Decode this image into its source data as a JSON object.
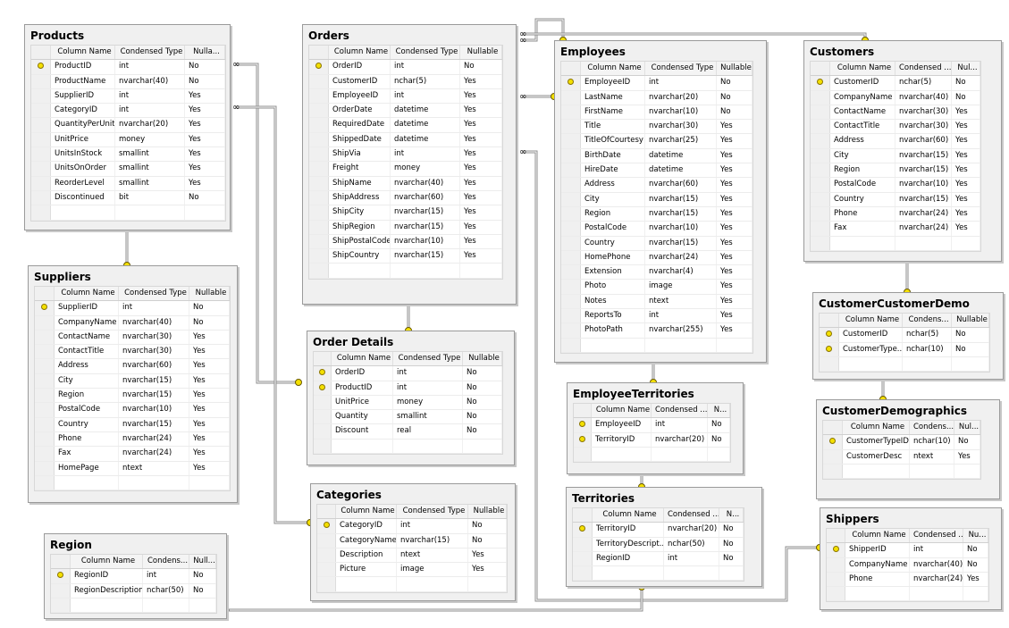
{
  "headers": [
    "Column Name",
    "Condensed Type",
    "Nullable"
  ],
  "colors": {
    "key": "#f4e000",
    "line": "#8c8c8c",
    "border": "#9a9a9a",
    "table_bg": "#f0f0f0"
  },
  "tables": [
    {
      "id": "products",
      "name": "Products",
      "headers": [
        "Column Name",
        "Condensed Type",
        "Nulla..."
      ],
      "rows": [
        [
          "ProductID",
          "int",
          "No",
          1
        ],
        [
          "ProductName",
          "nvarchar(40)",
          "No",
          0
        ],
        [
          "SupplierID",
          "int",
          "Yes",
          0
        ],
        [
          "CategoryID",
          "int",
          "Yes",
          0
        ],
        [
          "QuantityPerUnit",
          "nvarchar(20)",
          "Yes",
          0
        ],
        [
          "UnitPrice",
          "money",
          "Yes",
          0
        ],
        [
          "UnitsInStock",
          "smallint",
          "Yes",
          0
        ],
        [
          "UnitsOnOrder",
          "smallint",
          "Yes",
          0
        ],
        [
          "ReorderLevel",
          "smallint",
          "Yes",
          0
        ],
        [
          "Discontinued",
          "bit",
          "No",
          0
        ]
      ]
    },
    {
      "id": "orders",
      "name": "Orders",
      "headers": [
        "Column Name",
        "Condensed Type",
        "Nullable"
      ],
      "rows": [
        [
          "OrderID",
          "int",
          "No",
          1
        ],
        [
          "CustomerID",
          "nchar(5)",
          "Yes",
          0
        ],
        [
          "EmployeeID",
          "int",
          "Yes",
          0
        ],
        [
          "OrderDate",
          "datetime",
          "Yes",
          0
        ],
        [
          "RequiredDate",
          "datetime",
          "Yes",
          0
        ],
        [
          "ShippedDate",
          "datetime",
          "Yes",
          0
        ],
        [
          "ShipVia",
          "int",
          "Yes",
          0
        ],
        [
          "Freight",
          "money",
          "Yes",
          0
        ],
        [
          "ShipName",
          "nvarchar(40)",
          "Yes",
          0
        ],
        [
          "ShipAddress",
          "nvarchar(60)",
          "Yes",
          0
        ],
        [
          "ShipCity",
          "nvarchar(15)",
          "Yes",
          0
        ],
        [
          "ShipRegion",
          "nvarchar(15)",
          "Yes",
          0
        ],
        [
          "ShipPostalCode",
          "nvarchar(10)",
          "Yes",
          0
        ],
        [
          "ShipCountry",
          "nvarchar(15)",
          "Yes",
          0
        ]
      ]
    },
    {
      "id": "employees",
      "name": "Employees",
      "headers": [
        "Column Name",
        "Condensed Type",
        "Nullable"
      ],
      "rows": [
        [
          "EmployeeID",
          "int",
          "No",
          1
        ],
        [
          "LastName",
          "nvarchar(20)",
          "No",
          0
        ],
        [
          "FirstName",
          "nvarchar(10)",
          "No",
          0
        ],
        [
          "Title",
          "nvarchar(30)",
          "Yes",
          0
        ],
        [
          "TitleOfCourtesy",
          "nvarchar(25)",
          "Yes",
          0
        ],
        [
          "BirthDate",
          "datetime",
          "Yes",
          0
        ],
        [
          "HireDate",
          "datetime",
          "Yes",
          0
        ],
        [
          "Address",
          "nvarchar(60)",
          "Yes",
          0
        ],
        [
          "City",
          "nvarchar(15)",
          "Yes",
          0
        ],
        [
          "Region",
          "nvarchar(15)",
          "Yes",
          0
        ],
        [
          "PostalCode",
          "nvarchar(10)",
          "Yes",
          0
        ],
        [
          "Country",
          "nvarchar(15)",
          "Yes",
          0
        ],
        [
          "HomePhone",
          "nvarchar(24)",
          "Yes",
          0
        ],
        [
          "Extension",
          "nvarchar(4)",
          "Yes",
          0
        ],
        [
          "Photo",
          "image",
          "Yes",
          0
        ],
        [
          "Notes",
          "ntext",
          "Yes",
          0
        ],
        [
          "ReportsTo",
          "int",
          "Yes",
          0
        ],
        [
          "PhotoPath",
          "nvarchar(255)",
          "Yes",
          0
        ]
      ]
    },
    {
      "id": "customers",
      "name": "Customers",
      "headers": [
        "Column Name",
        "Condensed ...",
        "Nul..."
      ],
      "rows": [
        [
          "CustomerID",
          "nchar(5)",
          "No",
          1
        ],
        [
          "CompanyName",
          "nvarchar(40)",
          "No",
          0
        ],
        [
          "ContactName",
          "nvarchar(30)",
          "Yes",
          0
        ],
        [
          "ContactTitle",
          "nvarchar(30)",
          "Yes",
          0
        ],
        [
          "Address",
          "nvarchar(60)",
          "Yes",
          0
        ],
        [
          "City",
          "nvarchar(15)",
          "Yes",
          0
        ],
        [
          "Region",
          "nvarchar(15)",
          "Yes",
          0
        ],
        [
          "PostalCode",
          "nvarchar(10)",
          "Yes",
          0
        ],
        [
          "Country",
          "nvarchar(15)",
          "Yes",
          0
        ],
        [
          "Phone",
          "nvarchar(24)",
          "Yes",
          0
        ],
        [
          "Fax",
          "nvarchar(24)",
          "Yes",
          0
        ]
      ]
    },
    {
      "id": "suppliers",
      "name": "Suppliers",
      "headers": [
        "Column Name",
        "Condensed Type",
        "Nullable"
      ],
      "rows": [
        [
          "SupplierID",
          "int",
          "No",
          1
        ],
        [
          "CompanyName",
          "nvarchar(40)",
          "No",
          0
        ],
        [
          "ContactName",
          "nvarchar(30)",
          "Yes",
          0
        ],
        [
          "ContactTitle",
          "nvarchar(30)",
          "Yes",
          0
        ],
        [
          "Address",
          "nvarchar(60)",
          "Yes",
          0
        ],
        [
          "City",
          "nvarchar(15)",
          "Yes",
          0
        ],
        [
          "Region",
          "nvarchar(15)",
          "Yes",
          0
        ],
        [
          "PostalCode",
          "nvarchar(10)",
          "Yes",
          0
        ],
        [
          "Country",
          "nvarchar(15)",
          "Yes",
          0
        ],
        [
          "Phone",
          "nvarchar(24)",
          "Yes",
          0
        ],
        [
          "Fax",
          "nvarchar(24)",
          "Yes",
          0
        ],
        [
          "HomePage",
          "ntext",
          "Yes",
          0
        ]
      ]
    },
    {
      "id": "orderdetails",
      "name": "Order Details",
      "headers": [
        "Column Name",
        "Condensed Type",
        "Nullable"
      ],
      "rows": [
        [
          "OrderID",
          "int",
          "No",
          1
        ],
        [
          "ProductID",
          "int",
          "No",
          1
        ],
        [
          "UnitPrice",
          "money",
          "No",
          0
        ],
        [
          "Quantity",
          "smallint",
          "No",
          0
        ],
        [
          "Discount",
          "real",
          "No",
          0
        ]
      ]
    },
    {
      "id": "categories",
      "name": "Categories",
      "headers": [
        "Column Name",
        "Condensed Type",
        "Nullable"
      ],
      "rows": [
        [
          "CategoryID",
          "int",
          "No",
          1
        ],
        [
          "CategoryName",
          "nvarchar(15)",
          "No",
          0
        ],
        [
          "Description",
          "ntext",
          "Yes",
          0
        ],
        [
          "Picture",
          "image",
          "Yes",
          0
        ]
      ]
    },
    {
      "id": "region",
      "name": "Region",
      "headers": [
        "Column Name",
        "Condens...",
        "Null..."
      ],
      "rows": [
        [
          "RegionID",
          "int",
          "No",
          1
        ],
        [
          "RegionDescription",
          "nchar(50)",
          "No",
          0
        ]
      ]
    },
    {
      "id": "empterr",
      "name": "EmployeeTerritories",
      "headers": [
        "Column Name",
        "Condensed ...",
        "N..."
      ],
      "rows": [
        [
          "EmployeeID",
          "int",
          "No",
          1
        ],
        [
          "TerritoryID",
          "nvarchar(20)",
          "No",
          1
        ]
      ]
    },
    {
      "id": "territories",
      "name": "Territories",
      "headers": [
        "Column Name",
        "Condensed ...",
        "N..."
      ],
      "rows": [
        [
          "TerritoryID",
          "nvarchar(20)",
          "No",
          1
        ],
        [
          "TerritoryDescript...",
          "nchar(50)",
          "No",
          0
        ],
        [
          "RegionID",
          "int",
          "No",
          0
        ]
      ]
    },
    {
      "id": "ccd",
      "name": "CustomerCustomerDemo",
      "headers": [
        "Column Name",
        "Condens...",
        "Nullable"
      ],
      "rows": [
        [
          "CustomerID",
          "nchar(5)",
          "No",
          1
        ],
        [
          "CustomerType...",
          "nchar(10)",
          "No",
          1
        ]
      ]
    },
    {
      "id": "cdemo",
      "name": "CustomerDemographics",
      "headers": [
        "Column Name",
        "Condens...",
        "Nul..."
      ],
      "rows": [
        [
          "CustomerTypeID",
          "nchar(10)",
          "No",
          1
        ],
        [
          "CustomerDesc",
          "ntext",
          "Yes",
          0
        ]
      ]
    },
    {
      "id": "shippers",
      "name": "Shippers",
      "headers": [
        "Column Name",
        "Condensed ...",
        "Nu..."
      ],
      "rows": [
        [
          "ShipperID",
          "int",
          "No",
          1
        ],
        [
          "CompanyName",
          "nvarchar(40)",
          "No",
          0
        ],
        [
          "Phone",
          "nvarchar(24)",
          "Yes",
          0
        ]
      ]
    }
  ]
}
